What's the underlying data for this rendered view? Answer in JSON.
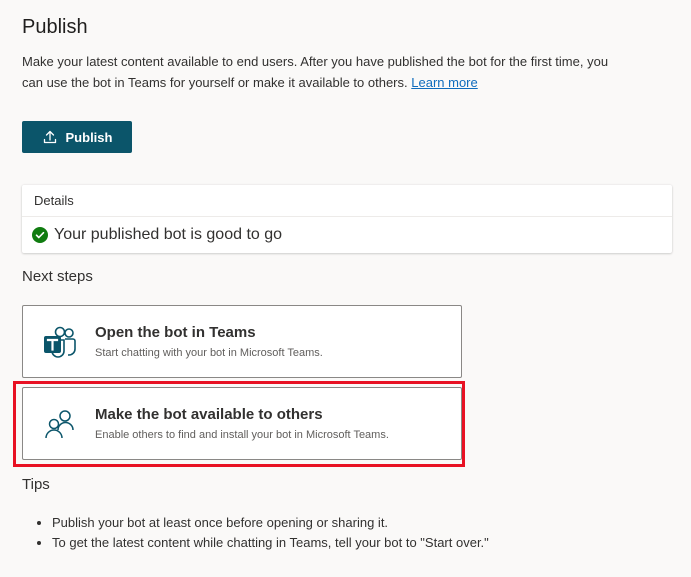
{
  "page": {
    "title": "Publish",
    "description": "Make your latest content available to end users. After you have published the bot for the first time, you can use the bot in Teams for yourself or make it available to others.",
    "learn_more": "Learn more"
  },
  "publish_button": {
    "label": "Publish",
    "icon": "upload-icon"
  },
  "details": {
    "header": "Details",
    "status_icon": "checkmark-circle-icon",
    "status_text": "Your published bot is good to go"
  },
  "next_steps": {
    "label": "Next steps",
    "items": [
      {
        "icon": "teams-icon",
        "title": "Open the bot in Teams",
        "subtitle": "Start chatting with your bot in Microsoft Teams."
      },
      {
        "icon": "people-icon",
        "title": "Make the bot available to others",
        "subtitle": "Enable others to find and install your bot in Microsoft Teams."
      }
    ]
  },
  "tips": {
    "label": "Tips",
    "items": [
      "Publish your bot at least once before opening or sharing it.",
      "To get the latest content while chatting in Teams, tell your bot to \"Start over.\""
    ]
  },
  "colors": {
    "primary_button": "#0b556a",
    "success": "#107c10",
    "link": "#0f6cbd",
    "highlight_box": "#e81123",
    "teams_purple": "#4b53bc"
  }
}
